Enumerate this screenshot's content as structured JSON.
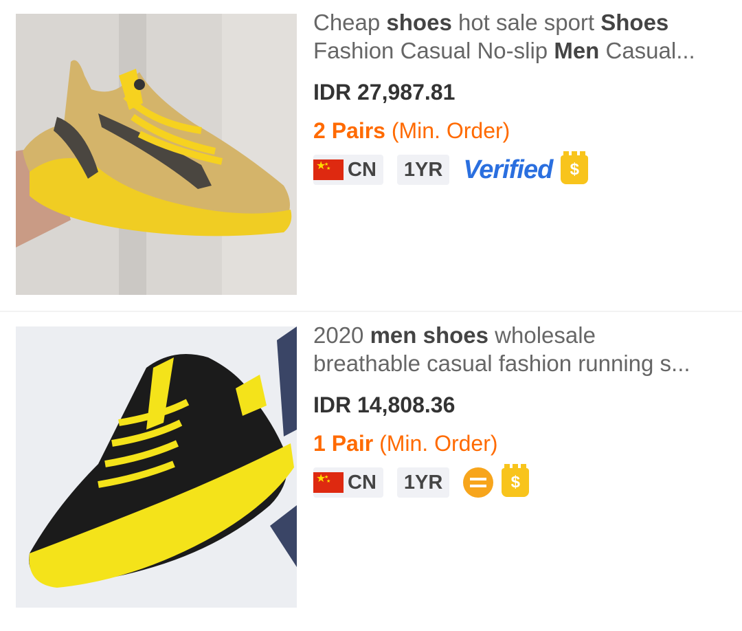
{
  "products": [
    {
      "title_line1_parts": [
        {
          "t": "Cheap ",
          "b": false
        },
        {
          "t": "shoes",
          "b": true
        },
        {
          "t": " hot sale sport ",
          "b": false
        },
        {
          "t": "Shoes",
          "b": true
        }
      ],
      "title_line2_parts": [
        {
          "t": "Fashion Casual No-slip ",
          "b": false
        },
        {
          "t": "Men",
          "b": true
        },
        {
          "t": " Casual...",
          "b": false
        }
      ],
      "price": "IDR 27,987.81",
      "moq_qty": "2 Pairs",
      "moq_label": " (Min. Order)",
      "country": "CN",
      "years": "1YR",
      "verified": "Verified",
      "gold_symbol": "$"
    },
    {
      "title_line1_parts": [
        {
          "t": "2020 ",
          "b": false
        },
        {
          "t": "men shoes",
          "b": true
        },
        {
          "t": " wholesale",
          "b": false
        }
      ],
      "title_line2_parts": [
        {
          "t": "breathable casual fashion running s...",
          "b": false
        }
      ],
      "price": "IDR 14,808.36",
      "moq_qty": "1 Pair",
      "moq_label": " (Min. Order)",
      "country": "CN",
      "years": "1YR",
      "gold_symbol": "$"
    }
  ],
  "colors": {
    "accent_orange": "#ff6a00",
    "verified_blue": "#2a6fdf",
    "gold": "#f8c41c"
  }
}
